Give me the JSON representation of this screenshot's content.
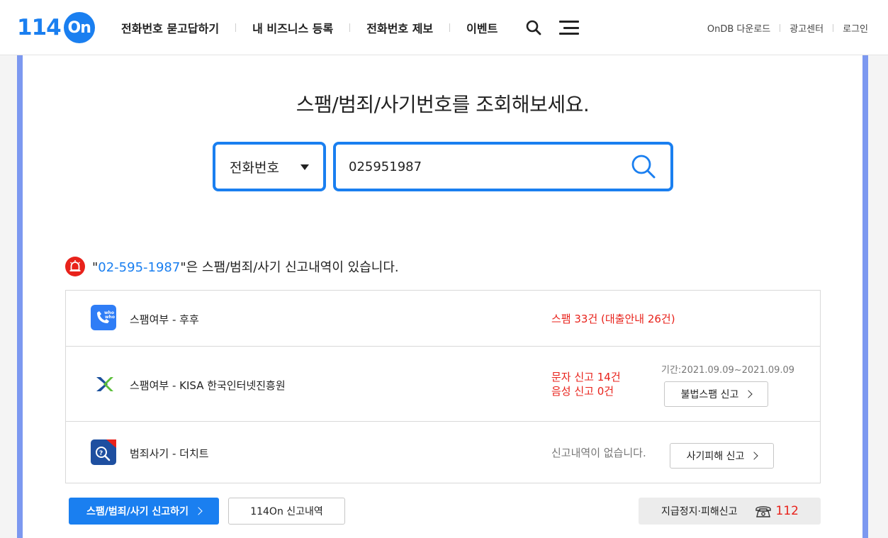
{
  "header": {
    "logo_num": "114",
    "logo_on": "On",
    "nav": [
      "전화번호 묻고답하기",
      "내 비즈니스 등록",
      "전화번호 제보",
      "이벤트"
    ],
    "util": [
      "OnDB 다운로드",
      "광고센터",
      "로그인"
    ]
  },
  "search": {
    "title": "스팸/범죄/사기번호를 조회해보세요.",
    "type_selected": "전화번호",
    "query": "025951987"
  },
  "result": {
    "number": "02-595-1987",
    "quote_open": "\"",
    "message": "\"은 스팸/범죄/사기 신고내역이 있습니다.",
    "rows": [
      {
        "label": "스팸여부 - 후후",
        "result": "스팸 33건 (대출안내 26건)",
        "icon": "whowho-icon"
      },
      {
        "label": "스팸여부 - KISA 한국인터넷진흥원",
        "result_line1": "문자 신고 14건",
        "result_line2": "음성 신고 0건",
        "period": "기간:2021.09.09~2021.09.09",
        "button": "불법스팸 신고",
        "icon": "kisa-icon"
      },
      {
        "label": "범죄사기 - 더치트",
        "result": "신고내역이 없습니다.",
        "button": "사기피해 신고",
        "icon": "thecheat-icon"
      }
    ]
  },
  "footer": {
    "report_button": "스팸/범죄/사기 신고하기",
    "history_button": "114On 신고내역",
    "stop_label": "지급정지·피해신고",
    "stop_number": "112"
  },
  "colors": {
    "accent": "#1a7ff0",
    "alert": "#e8221b",
    "frame": "#7c98f0"
  }
}
